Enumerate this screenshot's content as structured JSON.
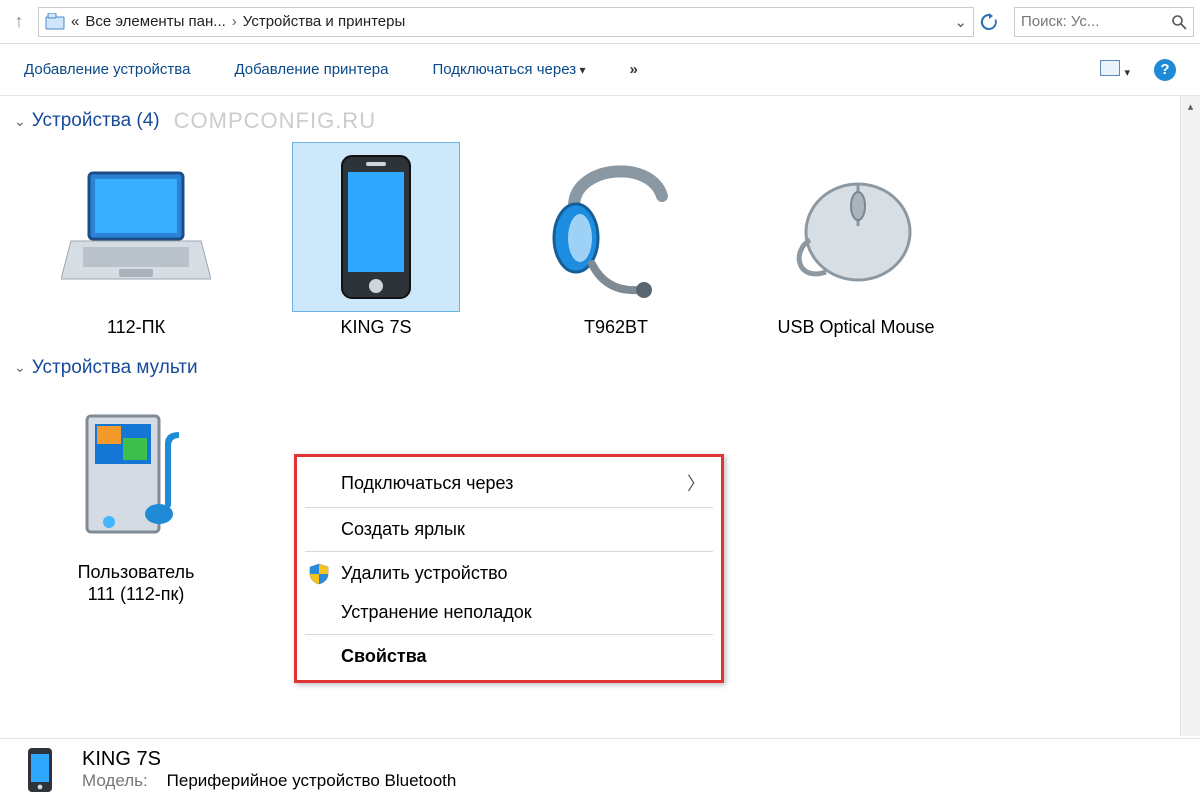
{
  "nav": {
    "crumb_prefix": "«",
    "crumb1": "Все элементы пан...",
    "crumb2": "Устройства и принтеры",
    "search_placeholder": "Поиск: Ус..."
  },
  "toolbar": {
    "add_device": "Добавление устройства",
    "add_printer": "Добавление принтера",
    "connect_via": "Подключаться через",
    "more": "»"
  },
  "groups": {
    "devices_label": "Устройства (4)",
    "multimedia_label": "Устройства мульти",
    "watermark": "COMPCONFIG.RU"
  },
  "devices": [
    {
      "label": "112-ПК"
    },
    {
      "label": "KING 7S"
    },
    {
      "label": "T962BT"
    },
    {
      "label": "USB Optical Mouse"
    }
  ],
  "multimedia": [
    {
      "label": "Пользователь\n111 (112-пк)"
    }
  ],
  "context_menu": {
    "connect_via": "Подключаться через",
    "create_shortcut": "Создать ярлык",
    "remove_device": "Удалить устройство",
    "troubleshoot": "Устранение неполадок",
    "properties": "Свойства"
  },
  "details": {
    "name": "KING 7S",
    "model_label": "Модель:",
    "model_value": "Периферийное устройство Bluetooth"
  }
}
